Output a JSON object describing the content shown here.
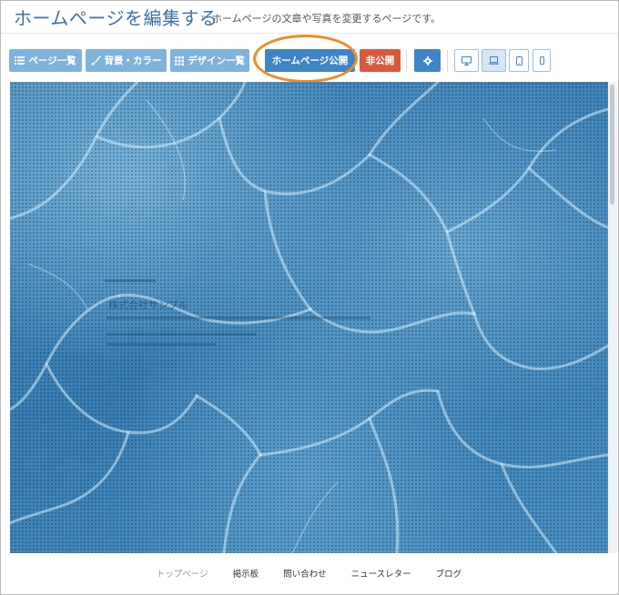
{
  "header": {
    "title": "ホームページを編集する",
    "separator": "»",
    "subtitle": "ホームページの文章や写真を変更するページです。"
  },
  "toolbar": {
    "page_list_label": "ページ一覧",
    "background_color_label": "背景・カラー",
    "design_list_label": "デザイン一覧",
    "publish_label": "ホームページ公開",
    "unpublish_label": "非公開"
  },
  "icons": {
    "page_list": "list-icon",
    "background_color": "brush-icon",
    "design_list": "grid-icon",
    "settings": "gear-icon",
    "devices": [
      "desktop-icon",
      "laptop-icon",
      "tablet-icon",
      "smartphone-icon"
    ]
  },
  "colors": {
    "title": "#3f6fa3",
    "button_light": "#7fb3dc",
    "button_primary": "#3f85c6",
    "button_danger": "#d9593f",
    "highlight_ring": "#f08a24"
  },
  "preview": {
    "company_name": "株式会社サンプル"
  },
  "footer_nav": [
    "トップページ",
    "掲示板",
    "問い合わせ",
    "ニュースレター",
    "ブログ"
  ]
}
